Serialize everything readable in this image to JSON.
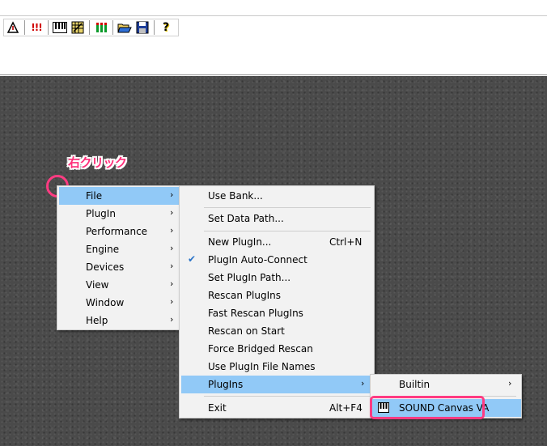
{
  "toolbar": {
    "buttons": [
      {
        "icon": "panic-triangle-icon"
      },
      {
        "icon": "midi-panic-icon",
        "text": "!!!"
      },
      {
        "icon": "keyboard-icon"
      },
      {
        "icon": "bank-grid-icon"
      },
      {
        "icon": "mixer-levels-icon"
      },
      {
        "icon": "open-folder-icon"
      },
      {
        "icon": "save-disk-icon"
      },
      {
        "icon": "help-icon",
        "text": "?"
      }
    ]
  },
  "annotation": {
    "label": "右クリック",
    "color": "#ff3b82"
  },
  "context_menu": {
    "items": [
      {
        "label": "File",
        "arrow": "›",
        "selected": true
      },
      {
        "label": "PlugIn",
        "arrow": "›"
      },
      {
        "label": "Performance",
        "arrow": "›"
      },
      {
        "label": "Engine",
        "arrow": "›"
      },
      {
        "label": "Devices",
        "arrow": "›"
      },
      {
        "label": "View",
        "arrow": "›"
      },
      {
        "label": "Window",
        "arrow": "›"
      },
      {
        "label": "Help",
        "arrow": "›"
      }
    ]
  },
  "file_menu": {
    "use_bank": "Use Bank...",
    "set_data_path": "Set Data Path...",
    "new_plugin": "New PlugIn...",
    "new_plugin_shortcut": "Ctrl+N",
    "plugin_auto_connect": "PlugIn Auto-Connect",
    "plugin_auto_connect_checked": "✔",
    "set_plugin_path": "Set PlugIn Path...",
    "rescan_plugins": "Rescan PlugIns",
    "fast_rescan_plugins": "Fast Rescan PlugIns",
    "rescan_on_start": "Rescan on Start",
    "force_bridged_rescan": "Force Bridged Rescan",
    "use_plugin_file_names": "Use PlugIn File Names",
    "plugins": "PlugIns",
    "plugins_arrow": "›",
    "exit": "Exit",
    "exit_shortcut": "Alt+F4"
  },
  "plugins_menu": {
    "builtin": "Builtin",
    "builtin_arrow": "›",
    "sound_canvas": "SOUND Canvas VA"
  },
  "colors": {
    "highlight": "#91c9f7",
    "menu_bg": "#f2f2f2",
    "workspace": "#4a4a4a",
    "annotation": "#ff3b82"
  }
}
